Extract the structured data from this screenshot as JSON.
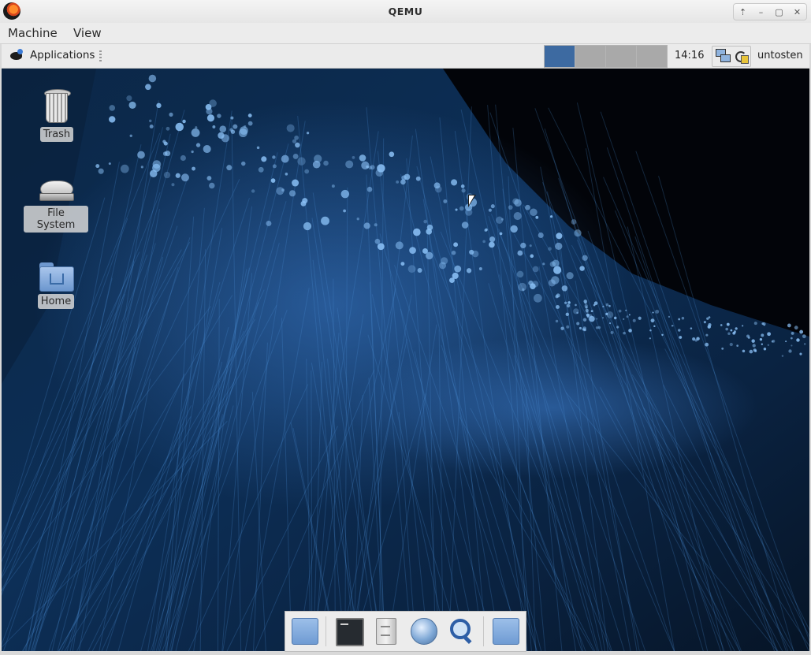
{
  "window": {
    "title": "QEMU",
    "buttons": [
      "⇡",
      "–",
      "▢",
      "✕"
    ]
  },
  "menubar": {
    "items": [
      "Machine",
      "View"
    ]
  },
  "panel": {
    "applications_label": "Applications",
    "workspace_colors": [
      "#3d6aa1",
      "#a9a9a9",
      "#a9a9a9",
      "#a9a9a9"
    ],
    "clock": "14:16",
    "user": "untosten"
  },
  "desktop": {
    "icons": [
      {
        "label": "Trash",
        "icon": "trash-icon"
      },
      {
        "label": "File System",
        "icon": "drive-icon"
      },
      {
        "label": "Home",
        "icon": "home-folder-icon"
      }
    ]
  },
  "dock": {
    "items": [
      "file-manager-icon",
      "terminal-icon",
      "file-cabinet-icon",
      "web-browser-icon",
      "search-icon",
      "folder-icon"
    ]
  }
}
